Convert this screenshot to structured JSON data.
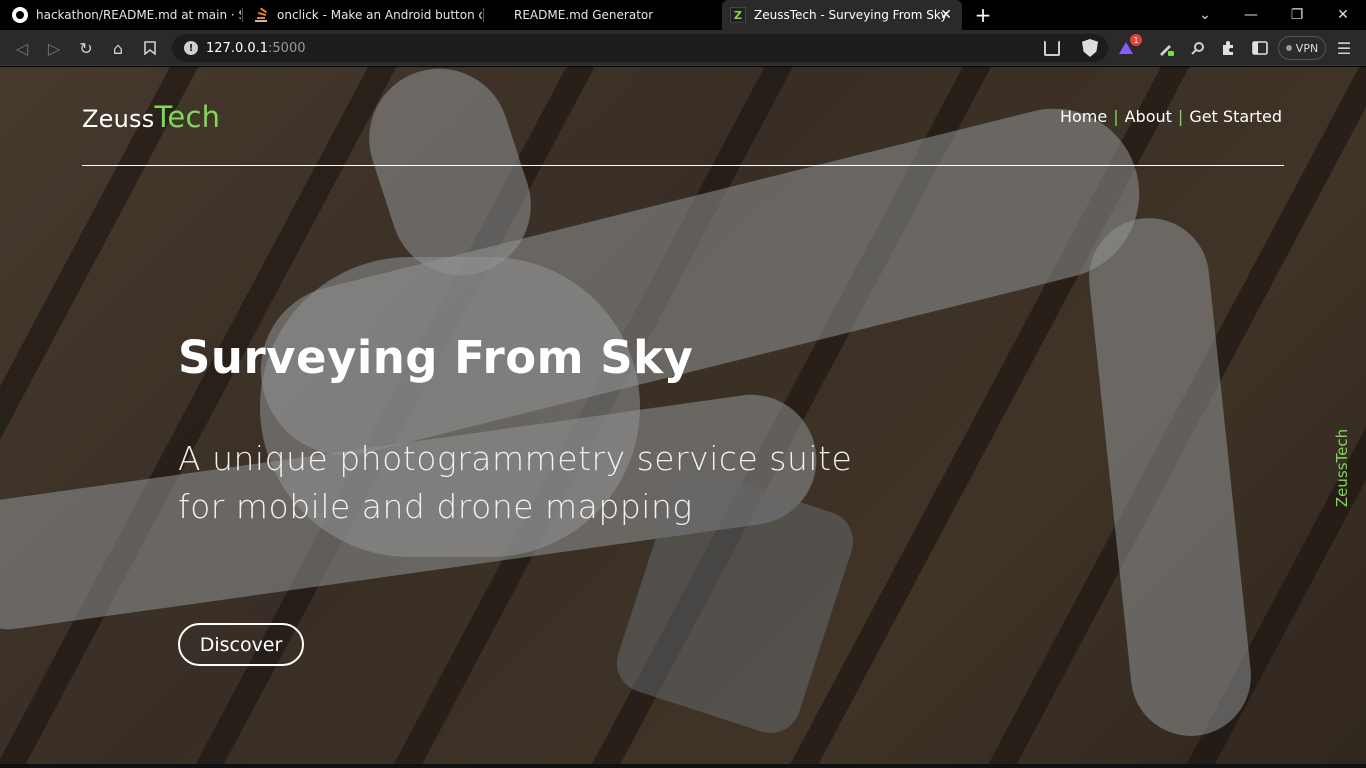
{
  "browser": {
    "tabs": [
      {
        "label": "hackathon/README.md at main · Saw",
        "icon": "github-icon"
      },
      {
        "label": "onclick - Make an Android button cha",
        "icon": "stackoverflow-icon"
      },
      {
        "label": "README.md Generator",
        "icon": ""
      },
      {
        "label": "ZeussTech - Surveying From Sky",
        "icon": "z-favicon",
        "active": true
      }
    ],
    "favicon_letter": "Z",
    "url_host": "127.0.0.1",
    "url_port": ":5000",
    "vpn_label": "VPN",
    "rewards_badge": "1"
  },
  "site": {
    "logo_main": "Zeuss",
    "logo_accent": "Tech",
    "nav": [
      "Home",
      "About",
      "Get Started"
    ],
    "nav_separator": "|",
    "hero_title": "Surveying From Sky",
    "hero_subtitle_line1": "A unique photogrammetry service suite",
    "hero_subtitle_line2": "for mobile and drone mapping",
    "cta_label": "Discover",
    "side_brand": "ZeussTech",
    "accent_color": "#7ed957"
  }
}
